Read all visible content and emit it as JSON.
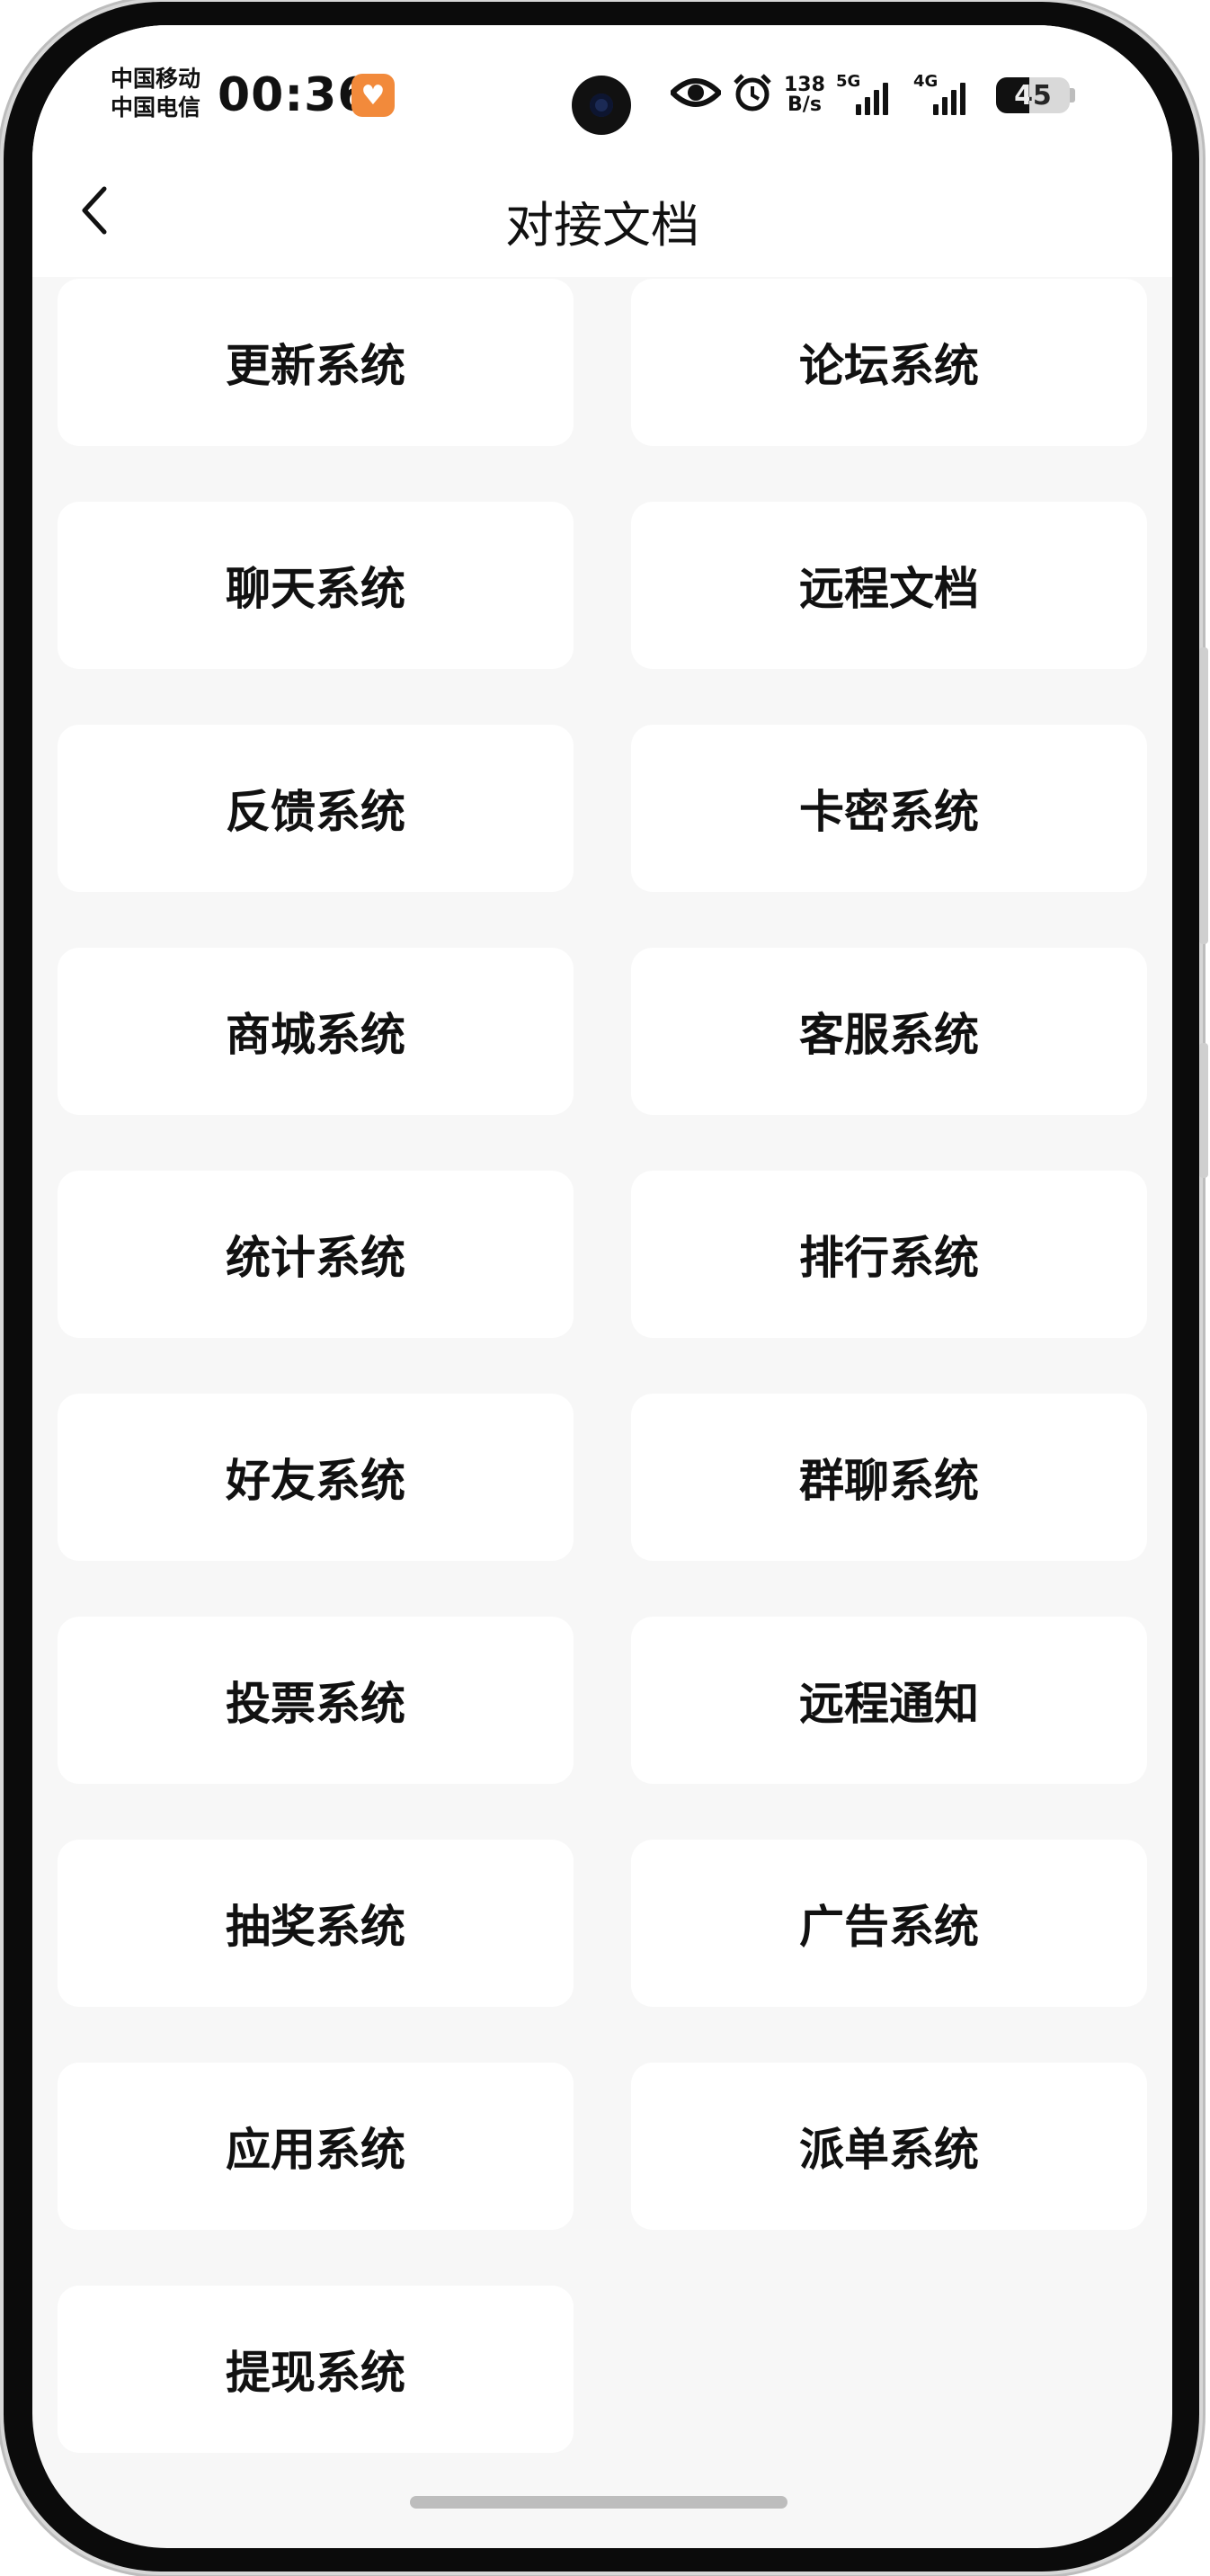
{
  "status_bar": {
    "carrier_1": "中国移动",
    "carrier_2": "中国电信",
    "time": "00:36",
    "net_speed_value": "138",
    "net_speed_unit": "B/s",
    "signal_1_label": "5G",
    "signal_2_label": "4G",
    "battery_percent": "45",
    "battery_level": 0.45,
    "app_badge_icon": "heart-icon",
    "icons": [
      "eye-icon",
      "alarm-icon"
    ]
  },
  "header": {
    "title": "对接文档",
    "back_icon": "chevron-left-icon"
  },
  "items": [
    {
      "label": "更新系统"
    },
    {
      "label": "论坛系统"
    },
    {
      "label": "聊天系统"
    },
    {
      "label": "远程文档"
    },
    {
      "label": "反馈系统"
    },
    {
      "label": "卡密系统"
    },
    {
      "label": "商城系统"
    },
    {
      "label": "客服系统"
    },
    {
      "label": "统计系统"
    },
    {
      "label": "排行系统"
    },
    {
      "label": "好友系统"
    },
    {
      "label": "群聊系统"
    },
    {
      "label": "投票系统"
    },
    {
      "label": "远程通知"
    },
    {
      "label": "抽奖系统"
    },
    {
      "label": "广告系统"
    },
    {
      "label": "应用系统"
    },
    {
      "label": "派单系统"
    },
    {
      "label": "提现系统"
    }
  ]
}
